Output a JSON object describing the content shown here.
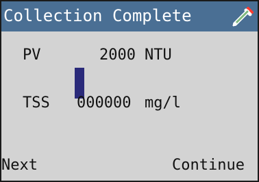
{
  "header": {
    "title": "Collection Complete",
    "icon": "dropper-icon",
    "background_color": "#4a6f94"
  },
  "readings": {
    "pv": {
      "label": "PV",
      "value": "2000",
      "unit": "NTU"
    },
    "tss": {
      "label": "TSS",
      "value": "000000",
      "unit": "mg/l"
    }
  },
  "softkeys": {
    "left": "Next",
    "right": "Continue"
  },
  "colors": {
    "screen_background": "#d3d3d3",
    "cursor": "#2a2a7a"
  }
}
